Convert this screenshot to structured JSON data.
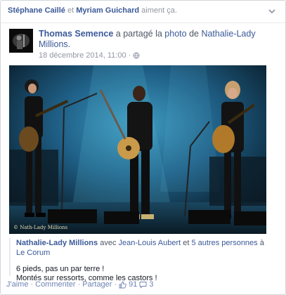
{
  "story_header": {
    "liker_1": "Stéphane Caillé",
    "connector": "et",
    "liker_2": "Myriam Guichard",
    "suffix": "aiment ça."
  },
  "post": {
    "author": "Thomas Semence",
    "shared_text": "a partagé la",
    "object_link": "photo",
    "of_text": "de",
    "owner": "Nathalie-Lady Millions.",
    "date": "18 décembre 2014, 11:00",
    "meta_separator": "·",
    "audience_icon": "globe-icon"
  },
  "photo": {
    "watermark": "© Nath-Lady Millions"
  },
  "tag_line": {
    "owner": "Nathalie-Lady Millions",
    "with_text": "avec",
    "person": "Jean-Louis Aubert",
    "and_text": "et",
    "others": "5 autres personnes",
    "at_text": "à",
    "place": "Le Corum"
  },
  "caption": {
    "line1": "6 pieds, pas un par terre !",
    "line2": "Montés sur ressorts, comme les castors !"
  },
  "actions": {
    "like": "J'aime",
    "comment": "Commenter",
    "share": "Partager",
    "dot": "·",
    "like_count": "91",
    "comment_count": "3"
  },
  "colors": {
    "link": "#3b5998",
    "action": "#6d84b4",
    "muted": "#9197a3",
    "stage_blue": "#1f5f86"
  }
}
